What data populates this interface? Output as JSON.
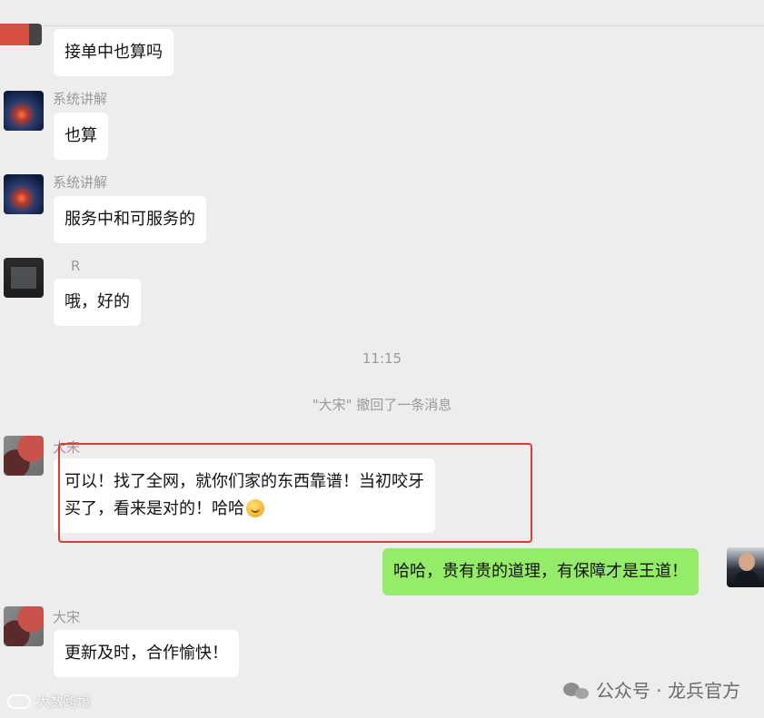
{
  "messages": [
    {
      "sender": "",
      "text": "接单中也算吗"
    },
    {
      "sender": "系统讲解",
      "text": "也算"
    },
    {
      "sender": "系统讲解",
      "text": "服务中和可服务的"
    },
    {
      "sender": "R",
      "text": "哦，好的"
    },
    {
      "sender": "大宋",
      "text_line1": "可以！找了全网，就你们家的东西靠谱！当初咬牙",
      "text_line2": "买了，看来是对的！哈哈"
    },
    {
      "sender": "",
      "text": "哈哈，贵有贵的道理，有保障才是王道！"
    },
    {
      "sender": "大宋",
      "text": "更新及时，合作愉快！"
    }
  ],
  "system": {
    "time": "11:15",
    "recall_notice": "\"大宋\" 撤回了一条消息"
  },
  "watermarks": {
    "right": "公众号 · 龙兵官方",
    "left": "大数跨境"
  },
  "colors": {
    "background": "#ededed",
    "bubble_left": "#ffffff",
    "bubble_right": "#95ec69",
    "highlight_box": "#e03a3a"
  },
  "icons": {
    "wechat": "wechat-logo-icon",
    "emoji": "grinning-emoji-icon"
  }
}
